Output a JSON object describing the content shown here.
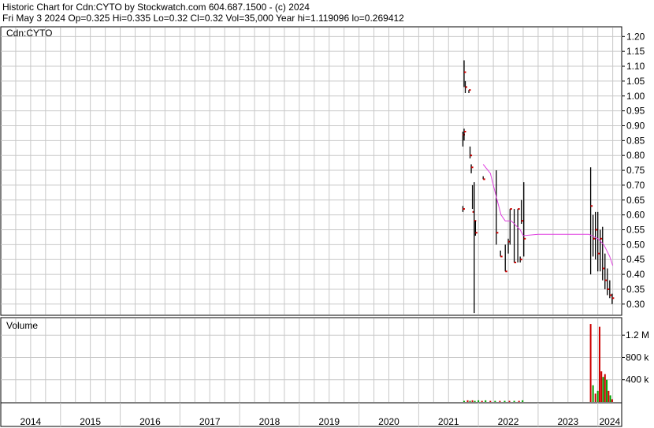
{
  "header": {
    "line1": "Historic Chart for Cdn:CYTO by Stockwatch.com 604.687.1500 - (c) 2024",
    "line2": "Fri May  3 2024  Op=0.325  Hi=0.335  Lo=0.32  Cl=0.32  Vol=35,000  Year hi=1.119096  lo=0.269412"
  },
  "chart_data": [
    {
      "type": "ohlc",
      "title": "Cdn:CYTO",
      "ylim": [
        0.265,
        1.23
      ],
      "yticks": [
        0.3,
        0.35,
        0.4,
        0.45,
        0.5,
        0.55,
        0.6,
        0.65,
        0.7,
        0.75,
        0.8,
        0.85,
        0.9,
        0.95,
        1.0,
        1.05,
        1.1,
        1.15,
        1.2
      ],
      "xlim": [
        2014.0,
        2024.4
      ],
      "x_categories": [
        "2014",
        "2015",
        "2016",
        "2017",
        "2018",
        "2019",
        "2020",
        "2021",
        "2022",
        "2023",
        "2024"
      ],
      "grid": true,
      "colors": {
        "bar": "#000000",
        "close_tick": "#cc0000",
        "moving_average": "#e040e0",
        "grid": "#c8c8c8"
      },
      "bars": [
        {
          "x": 2021.74,
          "h": 0.63,
          "l": 0.61,
          "c": 0.62
        },
        {
          "x": 2021.74,
          "h": 0.88,
          "l": 0.83,
          "c": 0.87
        },
        {
          "x": 2021.76,
          "h": 0.89,
          "l": 0.85,
          "c": 0.88
        },
        {
          "x": 2021.76,
          "h": 1.12,
          "l": 1.03,
          "c": 1.08
        },
        {
          "x": 2021.78,
          "h": 1.05,
          "l": 1.01,
          "c": 1.03
        },
        {
          "x": 2021.84,
          "h": 1.02,
          "l": 1.01,
          "c": 1.02
        },
        {
          "x": 2021.86,
          "h": 0.83,
          "l": 0.79,
          "c": 0.8
        },
        {
          "x": 2021.88,
          "h": 0.77,
          "l": 0.74,
          "c": 0.76
        },
        {
          "x": 2021.9,
          "h": 0.7,
          "l": 0.62,
          "c": 0.61
        },
        {
          "x": 2021.93,
          "h": 0.71,
          "l": 0.27,
          "c": 0.58
        },
        {
          "x": 2021.95,
          "h": 0.58,
          "l": 0.53,
          "c": 0.54
        },
        {
          "x": 2022.08,
          "h": 0.73,
          "l": 0.72,
          "c": 0.72
        },
        {
          "x": 2022.3,
          "h": 0.75,
          "l": 0.5,
          "c": 0.54
        },
        {
          "x": 2022.37,
          "h": 0.48,
          "l": 0.46,
          "c": 0.46
        },
        {
          "x": 2022.45,
          "h": 0.5,
          "l": 0.41,
          "c": 0.41
        },
        {
          "x": 2022.5,
          "h": 0.52,
          "l": 0.47,
          "c": 0.51
        },
        {
          "x": 2022.53,
          "h": 0.62,
          "l": 0.5,
          "c": 0.62
        },
        {
          "x": 2022.6,
          "h": 0.62,
          "l": 0.44,
          "c": 0.44
        },
        {
          "x": 2022.66,
          "h": 0.62,
          "l": 0.44,
          "c": 0.62
        },
        {
          "x": 2022.7,
          "h": 0.46,
          "l": 0.44,
          "c": 0.45
        },
        {
          "x": 2022.72,
          "h": 0.65,
          "l": 0.57,
          "c": 0.58
        },
        {
          "x": 2022.76,
          "h": 0.71,
          "l": 0.46,
          "c": 0.52
        },
        {
          "x": 2023.88,
          "h": 0.76,
          "l": 0.4,
          "c": 0.63
        },
        {
          "x": 2023.92,
          "h": 0.6,
          "l": 0.46,
          "c": 0.52
        },
        {
          "x": 2023.96,
          "h": 0.61,
          "l": 0.45,
          "c": 0.55
        },
        {
          "x": 2024.0,
          "h": 0.61,
          "l": 0.41,
          "c": 0.47
        },
        {
          "x": 2024.04,
          "h": 0.55,
          "l": 0.41,
          "c": 0.52
        },
        {
          "x": 2024.08,
          "h": 0.56,
          "l": 0.38,
          "c": 0.42
        },
        {
          "x": 2024.12,
          "h": 0.47,
          "l": 0.35,
          "c": 0.38
        },
        {
          "x": 2024.16,
          "h": 0.42,
          "l": 0.33,
          "c": 0.35
        },
        {
          "x": 2024.2,
          "h": 0.38,
          "l": 0.32,
          "c": 0.33
        },
        {
          "x": 2024.24,
          "h": 0.335,
          "l": 0.3,
          "c": 0.32
        }
      ],
      "moving_average": [
        [
          2022.08,
          0.77
        ],
        [
          2022.2,
          0.74
        ],
        [
          2022.3,
          0.66
        ],
        [
          2022.38,
          0.6
        ],
        [
          2022.45,
          0.58
        ],
        [
          2022.55,
          0.58
        ],
        [
          2022.7,
          0.55
        ],
        [
          2022.75,
          0.53
        ],
        [
          2023.0,
          0.535
        ],
        [
          2023.3,
          0.535
        ],
        [
          2023.6,
          0.535
        ],
        [
          2023.85,
          0.535
        ],
        [
          2024.0,
          0.52
        ],
        [
          2024.1,
          0.5
        ],
        [
          2024.2,
          0.46
        ],
        [
          2024.25,
          0.43
        ]
      ]
    },
    {
      "type": "bar",
      "title": "Volume",
      "ylim": [
        0,
        1.5
      ],
      "unit": "millions",
      "yticks": [
        0.4,
        0.8,
        1.2
      ],
      "ytick_labels": [
        "400 k",
        "800 k",
        "1.2 M"
      ],
      "colors": {
        "up": "#00a000",
        "down": "#cc0000"
      },
      "bars": [
        {
          "x": 2021.76,
          "v": 0.02,
          "d": "up"
        },
        {
          "x": 2021.82,
          "v": 0.03,
          "d": "down"
        },
        {
          "x": 2021.86,
          "v": 0.02,
          "d": "up"
        },
        {
          "x": 2021.9,
          "v": 0.03,
          "d": "down"
        },
        {
          "x": 2021.94,
          "v": 0.02,
          "d": "up"
        },
        {
          "x": 2022.0,
          "v": 0.03,
          "d": "up"
        },
        {
          "x": 2022.06,
          "v": 0.02,
          "d": "down"
        },
        {
          "x": 2022.12,
          "v": 0.03,
          "d": "up"
        },
        {
          "x": 2022.2,
          "v": 0.02,
          "d": "down"
        },
        {
          "x": 2022.28,
          "v": 0.02,
          "d": "up"
        },
        {
          "x": 2022.36,
          "v": 0.02,
          "d": "down"
        },
        {
          "x": 2022.44,
          "v": 0.02,
          "d": "up"
        },
        {
          "x": 2022.52,
          "v": 0.02,
          "d": "down"
        },
        {
          "x": 2022.6,
          "v": 0.02,
          "d": "up"
        },
        {
          "x": 2022.68,
          "v": 0.02,
          "d": "down"
        },
        {
          "x": 2022.74,
          "v": 0.03,
          "d": "up"
        },
        {
          "x": 2023.88,
          "v": 1.4,
          "d": "down"
        },
        {
          "x": 2023.92,
          "v": 0.3,
          "d": "up"
        },
        {
          "x": 2023.96,
          "v": 0.15,
          "d": "down"
        },
        {
          "x": 2024.0,
          "v": 0.2,
          "d": "up"
        },
        {
          "x": 2024.03,
          "v": 1.35,
          "d": "down"
        },
        {
          "x": 2024.06,
          "v": 0.55,
          "d": "down"
        },
        {
          "x": 2024.09,
          "v": 0.45,
          "d": "up"
        },
        {
          "x": 2024.12,
          "v": 0.5,
          "d": "down"
        },
        {
          "x": 2024.15,
          "v": 0.4,
          "d": "up"
        },
        {
          "x": 2024.18,
          "v": 0.2,
          "d": "down"
        },
        {
          "x": 2024.21,
          "v": 0.12,
          "d": "up"
        },
        {
          "x": 2024.24,
          "v": 0.05,
          "d": "down"
        }
      ]
    }
  ]
}
